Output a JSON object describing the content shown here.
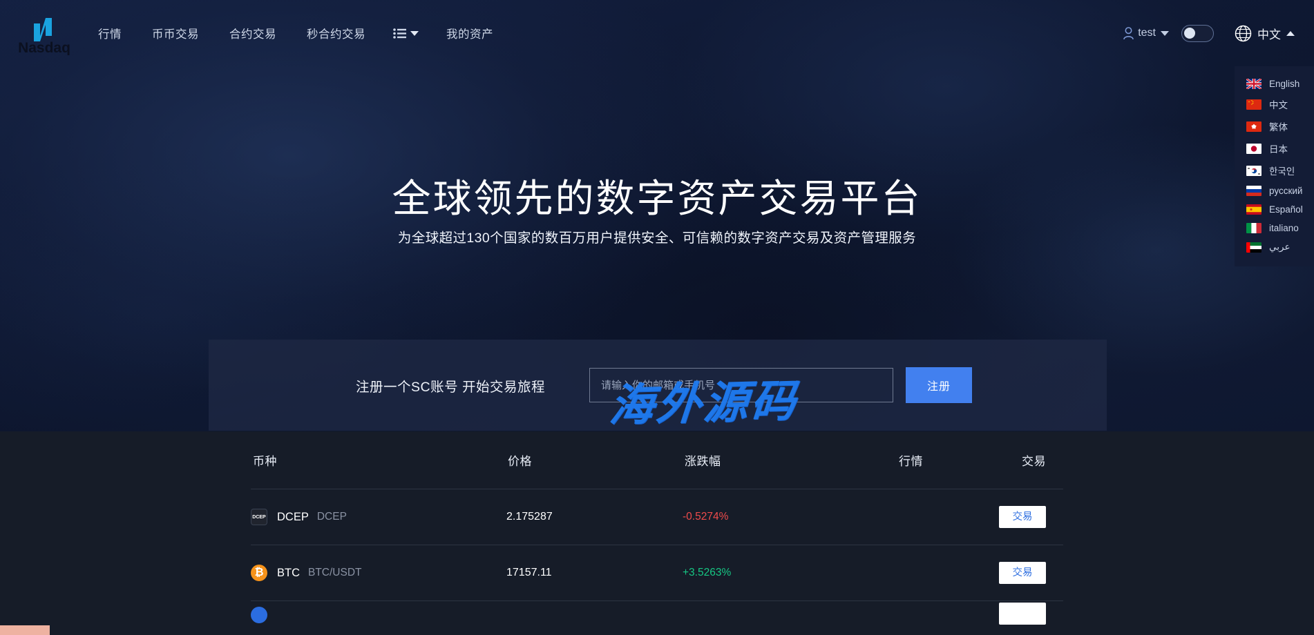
{
  "brand": {
    "name": "Nasdaq",
    "mark_color": "#1aa3e0"
  },
  "nav": {
    "items": [
      {
        "label": "行情"
      },
      {
        "label": "币币交易"
      },
      {
        "label": "合约交易"
      },
      {
        "label": "秒合约交易"
      }
    ],
    "more_menu_label": "",
    "my_assets_label": "我的资产"
  },
  "account": {
    "username": "test",
    "toggle_state": "off"
  },
  "language": {
    "current": "中文",
    "options": [
      {
        "label": "English",
        "flag": "uk"
      },
      {
        "label": "中文",
        "flag": "cn"
      },
      {
        "label": "繁体",
        "flag": "hk"
      },
      {
        "label": "日本",
        "flag": "jp"
      },
      {
        "label": "한국인",
        "flag": "kr"
      },
      {
        "label": "русский",
        "flag": "ru"
      },
      {
        "label": "Español",
        "flag": "es"
      },
      {
        "label": "italiano",
        "flag": "it"
      },
      {
        "label": "عربي",
        "flag": "ae"
      }
    ]
  },
  "hero": {
    "title": "全球领先的数字资产交易平台",
    "subtitle": "为全球超过130个国家的数百万用户提供安全、可信赖的数字资产交易及资产管理服务"
  },
  "cta": {
    "text": "注册一个SC账号 开始交易旅程",
    "input_value": "",
    "input_placeholder": "请输入你的邮箱或手机号",
    "button_label": "注册",
    "button_color": "#4280ef"
  },
  "watermark": {
    "text": "海外源码",
    "color": "#1f7bf0"
  },
  "market_table": {
    "headers": {
      "coin": "币种",
      "price": "价格",
      "change": "涨跌幅",
      "market": "行情",
      "trade": "交易"
    },
    "trade_button_label": "交易",
    "up_color": "#16c784",
    "down_color": "#ef4b4b",
    "rows": [
      {
        "icon": "dcep-coin-icon",
        "icon_text": "DCEP",
        "name": "DCEP",
        "pair": "DCEP",
        "price": "2.175287",
        "change": "-0.5274%",
        "direction": "down",
        "trade_label": "交易"
      },
      {
        "icon": "btc-coin-icon",
        "icon_text": "₿",
        "name": "BTC",
        "pair": "BTC/USDT",
        "price": "17157.11",
        "change": "+3.5263%",
        "direction": "up",
        "trade_label": "交易"
      }
    ]
  }
}
